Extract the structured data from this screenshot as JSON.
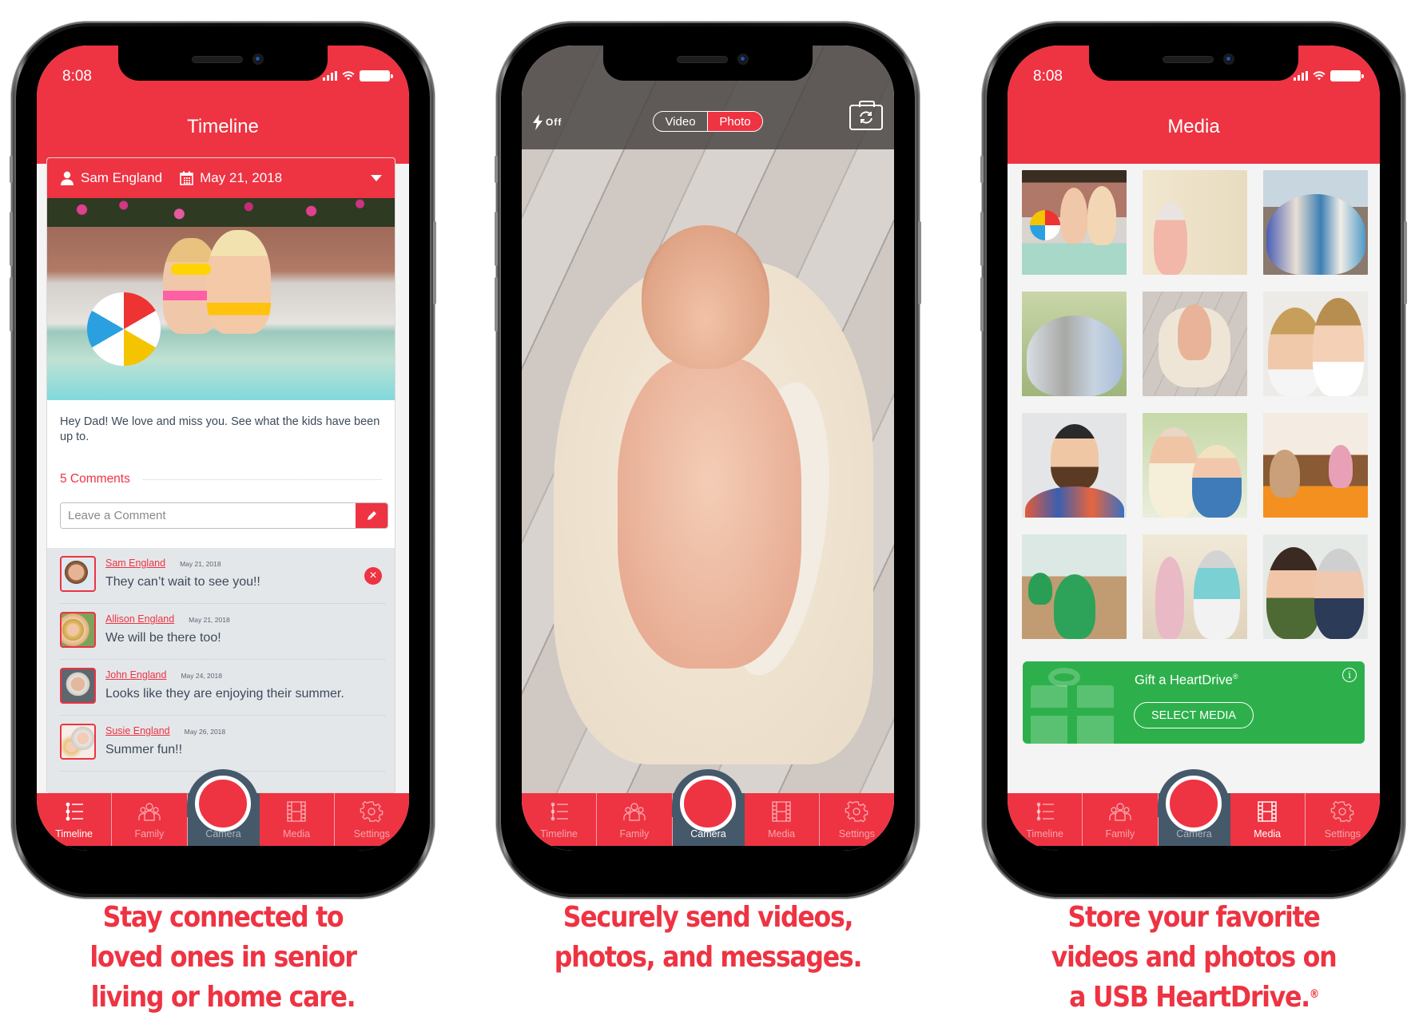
{
  "colors": {
    "brand_red": "#ee3342",
    "camera_slate": "#45596b",
    "gift_green": "#2db04b"
  },
  "status_bar": {
    "time": "8:08"
  },
  "tabs": [
    {
      "label": "Timeline",
      "icon": "timeline-icon"
    },
    {
      "label": "Family",
      "icon": "family-icon"
    },
    {
      "label": "Camera",
      "icon": "shutter-icon"
    },
    {
      "label": "Media",
      "icon": "film-icon"
    },
    {
      "label": "Settings",
      "icon": "gear-icon"
    }
  ],
  "phones": [
    {
      "screen": "timeline",
      "active_tab": "Timeline",
      "header_title": "Timeline",
      "post": {
        "author": "Sam England",
        "date": "May 21, 2018",
        "photo": "Two children in sunglasses sitting at a pool edge with a beach ball",
        "message": "Hey Dad! We love and miss you. See what the kids have been up to.",
        "comments_count_label": "5 Comments",
        "comment_placeholder": "Leave a Comment",
        "comments": [
          {
            "name": "Sam England",
            "date": "May 21, 2018",
            "text": "They can’t wait to see you!!",
            "deletable": true
          },
          {
            "name": "Allison England",
            "date": "May 21, 2018",
            "text": "We will be there too!"
          },
          {
            "name": "John England",
            "date": "May 24, 2018",
            "text": "Looks like they are enjoying their summer."
          },
          {
            "name": "Susie England",
            "date": "May 26, 2018",
            "text": "Summer fun!!"
          }
        ]
      }
    },
    {
      "screen": "camera",
      "active_tab": "Camera",
      "flash_label": "Off",
      "mode_options": [
        "Video",
        "Photo"
      ],
      "selected_mode": "Photo",
      "viewfinder": "Sleeping newborn baby in a cream knit blanket on wooden floor"
    },
    {
      "screen": "media",
      "active_tab": "Media",
      "header_title": "Media",
      "media_items": [
        "Kids at pool",
        "Seniors dancing",
        "Friends group selfie",
        "Senior friends outdoors",
        "Newborn baby",
        "Mother and daughter",
        "Smiling bearded man",
        "Senior couple",
        "Residents in dining room",
        "Seniors at table",
        "Senior exercise class",
        "Woman hugging grandmother"
      ],
      "gift_banner": {
        "title": "Gift a HeartDrive",
        "reg_mark": "®",
        "button_label": "SELECT MEDIA",
        "info_icon": "i"
      }
    }
  ],
  "captions": [
    {
      "lines": [
        "Stay connected to",
        "loved ones in senior",
        "living or home care."
      ]
    },
    {
      "lines": [
        "Securely send videos,",
        "photos, and messages."
      ]
    },
    {
      "lines": [
        "Store your favorite",
        "videos and photos on",
        "a USB HeartDrive."
      ],
      "reg_mark": "®"
    }
  ]
}
